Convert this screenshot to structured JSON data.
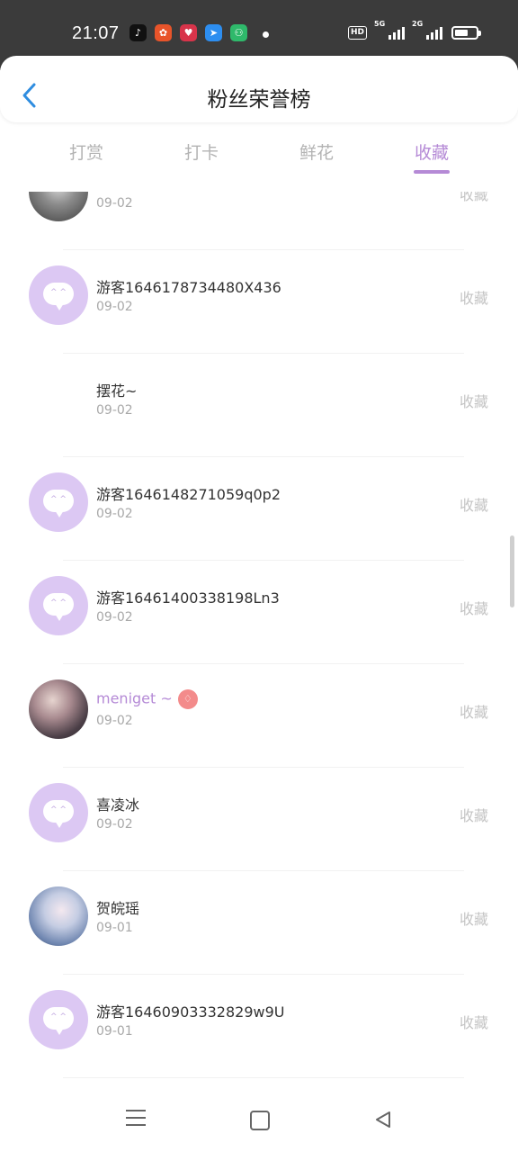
{
  "status": {
    "time": "21:07",
    "hd_label": "HD",
    "net1": "5G",
    "net2": "2G",
    "battery_level": 0.65
  },
  "header": {
    "title": "粉丝荣誉榜"
  },
  "tabs": [
    {
      "label": "打赏"
    },
    {
      "label": "打卡"
    },
    {
      "label": "鲜花"
    },
    {
      "label": "收藏"
    }
  ],
  "active_tab": "收藏",
  "list": [
    {
      "name": "",
      "date": "09-02",
      "action": "收藏",
      "avatar": "photo-dark"
    },
    {
      "name": "游客1646178734480X436",
      "date": "09-02",
      "action": "收藏",
      "avatar": "default"
    },
    {
      "name": "摆花~",
      "date": "09-02",
      "action": "收藏",
      "avatar": "none"
    },
    {
      "name": "游客1646148271059q0p2",
      "date": "09-02",
      "action": "收藏",
      "avatar": "default"
    },
    {
      "name": "游客16461400338198Ln3",
      "date": "09-02",
      "action": "收藏",
      "avatar": "default"
    },
    {
      "name": "meniget ~",
      "date": "09-02",
      "action": "收藏",
      "avatar": "photo-anime-girl",
      "vip": true
    },
    {
      "name": "喜凌冰",
      "date": "09-02",
      "action": "收藏",
      "avatar": "default"
    },
    {
      "name": "贺皖瑶",
      "date": "09-01",
      "action": "收藏",
      "avatar": "photo-anime-blue"
    },
    {
      "name": "游客16460903332829w9U",
      "date": "09-01",
      "action": "收藏",
      "avatar": "default"
    }
  ],
  "colors": {
    "accent": "#b58ad6",
    "avatar_default": "#dcc8f3",
    "vip_badge": "#f38b8b"
  }
}
